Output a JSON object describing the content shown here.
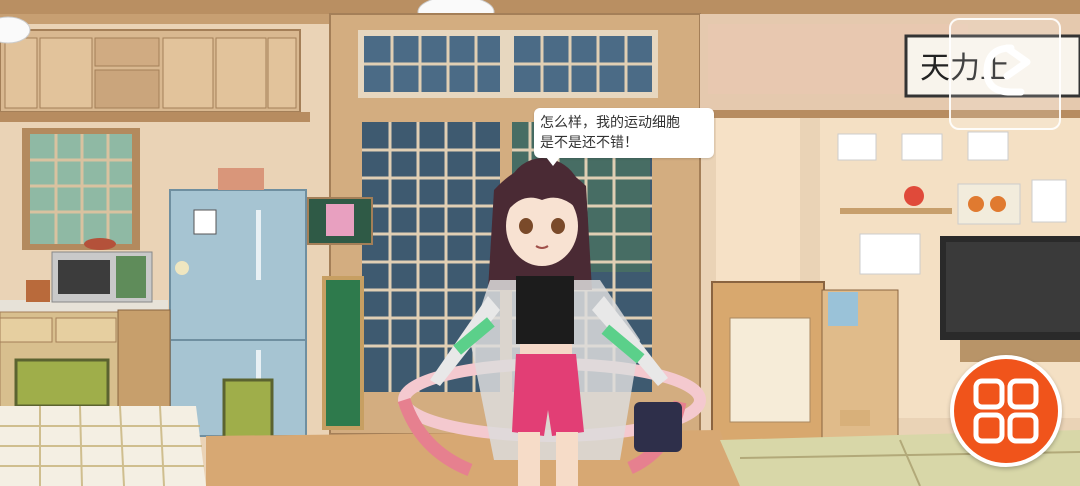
{
  "dialogue": {
    "line1": "怎么样，我的运动细胞",
    "line2": "是不是还不错！"
  },
  "controls": {
    "exit_icon": "exit-arrow-icon",
    "menu_icon": "grid-menu-icon",
    "menu_color": "#f0541b"
  },
  "scene": {
    "character": "anime-girl-with-hula-hoop",
    "setting": "japanese-home-interior"
  }
}
